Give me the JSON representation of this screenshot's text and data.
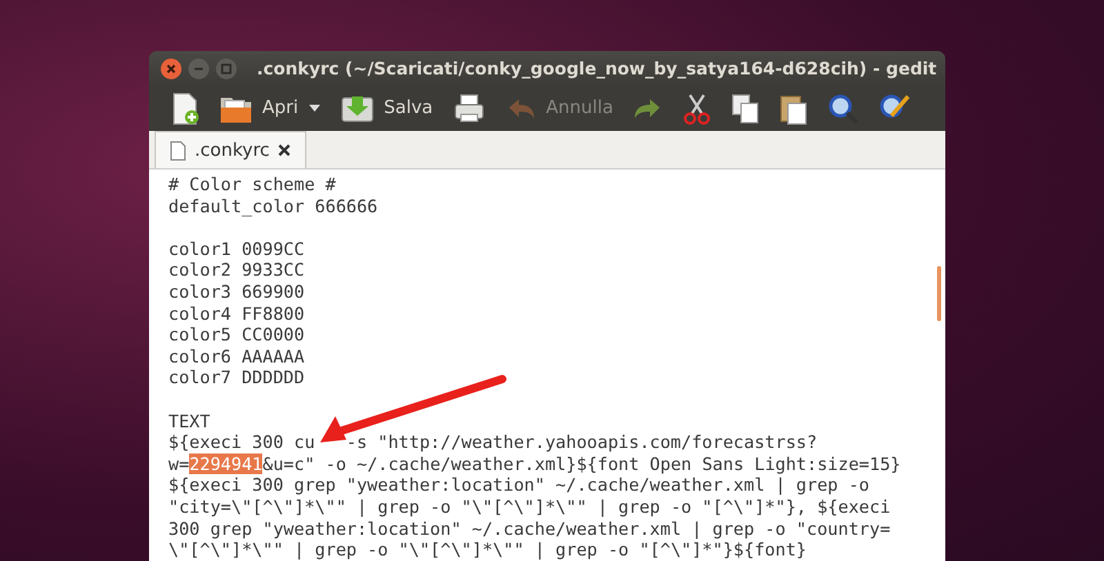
{
  "window": {
    "title": ".conkyrc (~/Scaricati/conky_google_now_by_satya164-d628cih) - gedit"
  },
  "toolbar": [
    {
      "kind": "new",
      "disabled": false
    },
    {
      "kind": "open",
      "label": "Apri",
      "disabled": false
    },
    {
      "kind": "dropdown",
      "disabled": false
    },
    {
      "kind": "save",
      "label": "Salva",
      "disabled": false
    },
    {
      "kind": "print",
      "disabled": false
    },
    {
      "kind": "undo",
      "label": "Annulla",
      "disabled": true
    },
    {
      "kind": "redo",
      "disabled": false
    },
    {
      "kind": "cut",
      "disabled": false
    },
    {
      "kind": "copy",
      "disabled": false
    },
    {
      "kind": "paste",
      "disabled": false
    },
    {
      "kind": "search",
      "disabled": false
    },
    {
      "kind": "replace",
      "disabled": false
    }
  ],
  "tabs": [
    {
      "label": ".conkyrc",
      "selected": true
    }
  ],
  "editor": {
    "lines": [
      {
        "kind": "code",
        "parts": [
          {
            "kind": "plain",
            "text": "# Color scheme #"
          }
        ]
      },
      {
        "kind": "code",
        "parts": [
          {
            "kind": "plain",
            "text": "default_color 666666"
          }
        ]
      },
      {
        "kind": "blank"
      },
      {
        "kind": "code",
        "parts": [
          {
            "kind": "plain",
            "text": "color1 0099CC"
          }
        ]
      },
      {
        "kind": "code",
        "parts": [
          {
            "kind": "plain",
            "text": "color2 9933CC"
          }
        ]
      },
      {
        "kind": "code",
        "parts": [
          {
            "kind": "plain",
            "text": "color3 669900"
          }
        ]
      },
      {
        "kind": "code",
        "parts": [
          {
            "kind": "plain",
            "text": "color4 FF8800"
          }
        ]
      },
      {
        "kind": "code",
        "parts": [
          {
            "kind": "plain",
            "text": "color5 CC0000"
          }
        ]
      },
      {
        "kind": "code",
        "parts": [
          {
            "kind": "plain",
            "text": "color6 AAAAAA"
          }
        ]
      },
      {
        "kind": "code",
        "parts": [
          {
            "kind": "plain",
            "text": "color7 DDDDDD"
          }
        ]
      },
      {
        "kind": "blank"
      },
      {
        "kind": "code",
        "parts": [
          {
            "kind": "plain",
            "text": "TEXT"
          }
        ]
      },
      {
        "kind": "code",
        "parts": [
          {
            "kind": "plain",
            "text": "${execi 300 cu"
          },
          {
            "kind": "covered"
          },
          {
            "kind": "plain",
            "text": "-s \"http://weather.yahooapis.com/forecastrss?"
          }
        ]
      },
      {
        "kind": "code",
        "parts": [
          {
            "kind": "plain",
            "text": "w="
          },
          {
            "kind": "selected",
            "text": "2294941"
          },
          {
            "kind": "plain",
            "text": "&u=c\" -o ~/.cache/weather.xml}${font Open Sans Light:size=15}"
          }
        ]
      },
      {
        "kind": "code",
        "parts": [
          {
            "kind": "plain",
            "text": "${execi 300 grep \"yweather:location\" ~/.cache/weather.xml | grep -o"
          }
        ]
      },
      {
        "kind": "code",
        "parts": [
          {
            "kind": "plain",
            "text": "\"city=\\\"[^\\\"]*\\\"\" | grep -o \"\\\"[^\\\"]*\\\"\" | grep -o \"[^\\\"]*\"}, ${execi"
          }
        ]
      },
      {
        "kind": "code",
        "parts": [
          {
            "kind": "plain",
            "text": "300 grep \"yweather:location\" ~/.cache/weather.xml | grep -o \"country="
          }
        ]
      },
      {
        "kind": "code",
        "parts": [
          {
            "kind": "plain",
            "text": "\\\"[^\\\"]*\\\"\" | grep -o \"\\\"[^\\\"]*\\\"\" | grep -o \"[^\\\"]*\"}${font}"
          }
        ]
      }
    ]
  }
}
